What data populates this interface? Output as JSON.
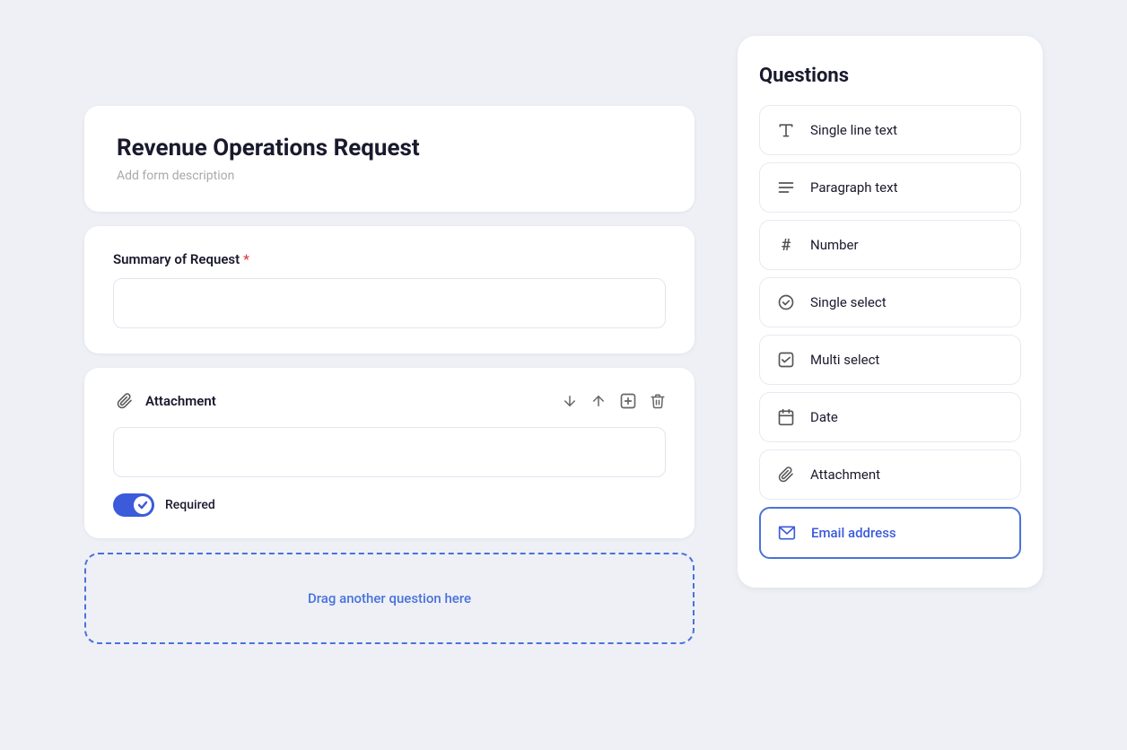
{
  "left": {
    "form_title": "Revenue Operations Request",
    "form_description": "Add form description",
    "summary_label": "Summary of Request",
    "summary_required": true,
    "attachment_label": "Attachment",
    "required_toggle_label": "Required",
    "drag_zone_text": "Drag another question here"
  },
  "right": {
    "panel_title": "Questions",
    "items": [
      {
        "id": "single-line-text",
        "label": "Single line text",
        "icon": "A"
      },
      {
        "id": "paragraph-text",
        "label": "Paragraph text",
        "icon": "AE"
      },
      {
        "id": "number",
        "label": "Number",
        "icon": "#"
      },
      {
        "id": "single-select",
        "label": "Single select",
        "icon": "circle-down"
      },
      {
        "id": "multi-select",
        "label": "Multi select",
        "icon": "checkbox"
      },
      {
        "id": "date",
        "label": "Date",
        "icon": "calendar"
      },
      {
        "id": "attachment",
        "label": "Attachment",
        "icon": "paperclip"
      },
      {
        "id": "email-address",
        "label": "Email address",
        "icon": "email",
        "active": true
      }
    ]
  },
  "icons": {
    "down_arrow": "↓",
    "up_arrow": "↑",
    "add": "⊕",
    "delete": "🗑"
  }
}
